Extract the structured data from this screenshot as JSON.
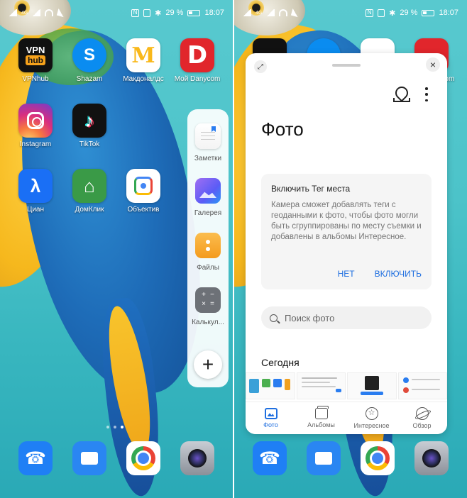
{
  "status_bar": {
    "network_tag": "4G",
    "battery": "29 %",
    "time": "18:07"
  },
  "left_screen": {
    "apps": [
      {
        "label": "VPNhub",
        "icon_text": "VPN",
        "icon_sub": "hub",
        "icon": "vpnhub-icon"
      },
      {
        "label": "Shazam",
        "icon_text": "S",
        "icon": "shazam-icon"
      },
      {
        "label": "Макдоналдс",
        "icon_text": "M",
        "icon": "mcdonalds-icon"
      },
      {
        "label": "Мой Danycom",
        "icon_text": "D",
        "icon": "danycom-icon"
      },
      {
        "label": "Instagram",
        "icon": "instagram-icon"
      },
      {
        "label": "TikTok",
        "icon_text": "♪",
        "icon": "tiktok-icon"
      },
      {
        "label": "Циан",
        "icon_text": "λ",
        "icon": "cian-icon"
      },
      {
        "label": "ДомКлик",
        "icon_text": "⌂",
        "icon": "domclick-icon"
      },
      {
        "label": "Объектив",
        "icon": "google-lens-icon"
      }
    ],
    "side_dock": [
      {
        "label": "Заметки",
        "icon": "notes-icon"
      },
      {
        "label": "Галерея",
        "icon": "gallery-icon"
      },
      {
        "label": "Файлы",
        "icon": "files-icon"
      },
      {
        "label": "Калькул...",
        "icon": "calculator-icon"
      }
    ],
    "add_label": "+"
  },
  "right_screen": {
    "top_apps": [
      {
        "label": "Мой Danycom",
        "icon": "danycom-icon"
      }
    ],
    "photos_window": {
      "title": "Фото",
      "tag_card": {
        "title": "Включить Тег места",
        "body": "Камера сможет добавлять теги с геоданными к фото, чтобы фото могли быть сгруппированы по месту съемки и добавлены в альбомы Интересное.",
        "no_label": "НЕТ",
        "enable_label": "ВКЛЮЧИТЬ"
      },
      "search_placeholder": "Поиск фото",
      "section_today": "Сегодня",
      "tabs": [
        {
          "label": "Фото",
          "icon": "photo-icon",
          "active": true
        },
        {
          "label": "Альбомы",
          "icon": "albums-icon",
          "active": false
        },
        {
          "label": "Интересное",
          "icon": "star-icon",
          "active": false
        },
        {
          "label": "Обзор",
          "icon": "discover-icon",
          "active": false
        }
      ]
    }
  },
  "bottom_dock": [
    {
      "icon": "phone-icon"
    },
    {
      "icon": "messages-icon"
    },
    {
      "icon": "chrome-icon"
    },
    {
      "icon": "camera-icon"
    }
  ],
  "colors": {
    "accent_blue": "#1f6fe0",
    "wallpaper_teal": "#4cc3c9"
  }
}
